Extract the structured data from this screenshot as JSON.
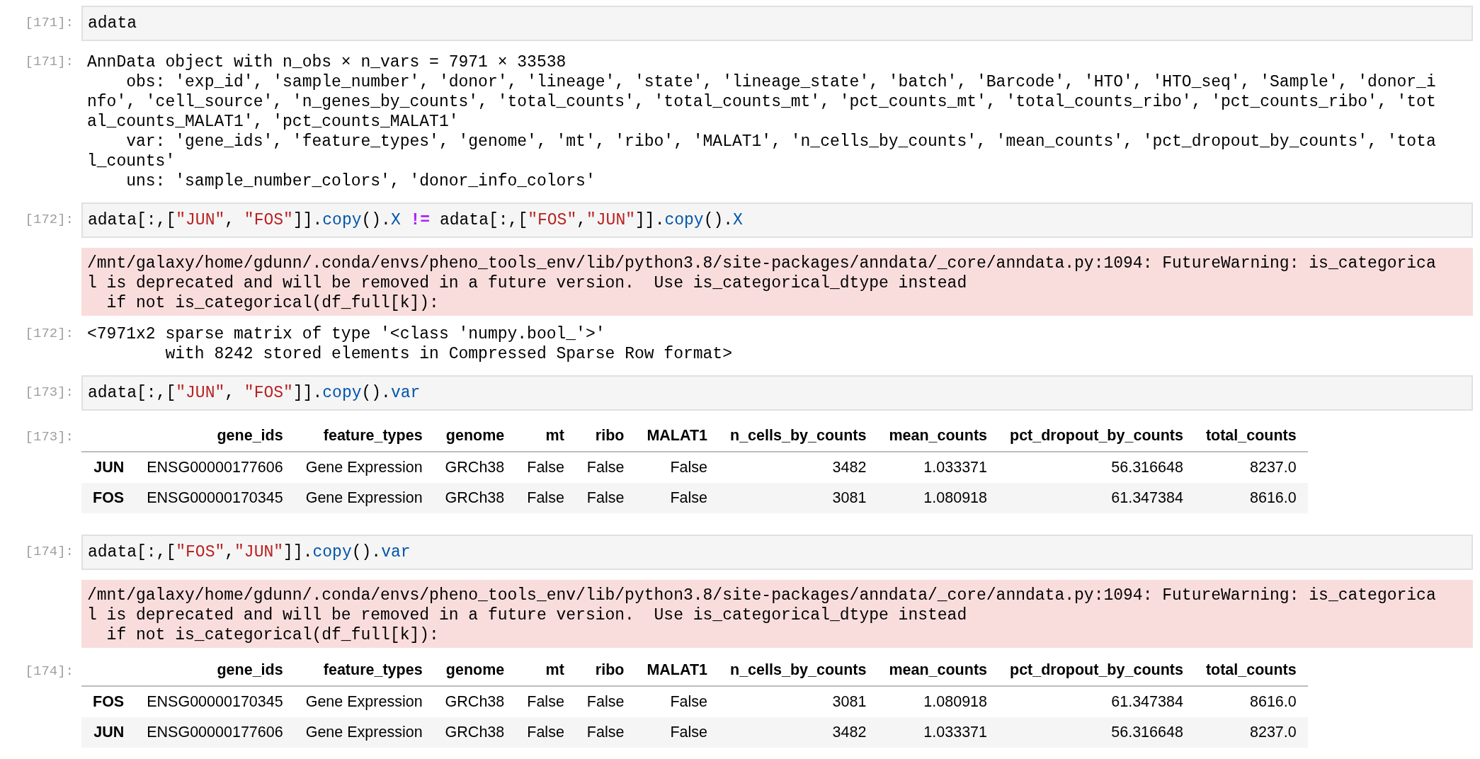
{
  "cells": [
    {
      "kind": "input",
      "prompt": "[171]:",
      "code": [
        {
          "kind": "plain",
          "text": "adata"
        }
      ]
    },
    {
      "kind": "text",
      "prompt": "[171]:",
      "text": "AnnData object with n_obs × n_vars = 7971 × 33538\n    obs: 'exp_id', 'sample_number', 'donor', 'lineage', 'state', 'lineage_state', 'batch', 'Barcode', 'HTO', 'HTO_seq', 'Sample', 'donor_i\nnfo', 'cell_source', 'n_genes_by_counts', 'total_counts', 'total_counts_mt', 'pct_counts_mt', 'total_counts_ribo', 'pct_counts_ribo', 'tot\nal_counts_MALAT1', 'pct_counts_MALAT1'\n    var: 'gene_ids', 'feature_types', 'genome', 'mt', 'ribo', 'MALAT1', 'n_cells_by_counts', 'mean_counts', 'pct_dropout_by_counts', 'tota\nl_counts'\n    uns: 'sample_number_colors', 'donor_info_colors'"
    },
    {
      "kind": "input",
      "prompt": "[172]:",
      "code": [
        {
          "kind": "plain",
          "text": "adata[:,["
        },
        {
          "kind": "string",
          "text": "\"JUN\""
        },
        {
          "kind": "plain",
          "text": ", "
        },
        {
          "kind": "string",
          "text": "\"FOS\""
        },
        {
          "kind": "plain",
          "text": "]]."
        },
        {
          "kind": "attr",
          "text": "copy"
        },
        {
          "kind": "plain",
          "text": "()."
        },
        {
          "kind": "attr",
          "text": "X "
        },
        {
          "kind": "operator",
          "text": "!="
        },
        {
          "kind": "plain",
          "text": " adata[:,["
        },
        {
          "kind": "string",
          "text": "\"FOS\""
        },
        {
          "kind": "plain",
          "text": ","
        },
        {
          "kind": "string",
          "text": "\"JUN\""
        },
        {
          "kind": "plain",
          "text": "]]."
        },
        {
          "kind": "attr",
          "text": "copy"
        },
        {
          "kind": "plain",
          "text": "()."
        },
        {
          "kind": "attr",
          "text": "X"
        }
      ]
    },
    {
      "kind": "stderr",
      "text": "/mnt/galaxy/home/gdunn/.conda/envs/pheno_tools_env/lib/python3.8/site-packages/anndata/_core/anndata.py:1094: FutureWarning: is_categorica\nl is deprecated and will be removed in a future version.  Use is_categorical_dtype instead\n  if not is_categorical(df_full[k]):"
    },
    {
      "kind": "text",
      "prompt": "[172]:",
      "text": "<7971x2 sparse matrix of type '<class 'numpy.bool_'>'\n\twith 8242 stored elements in Compressed Sparse Row format>"
    },
    {
      "kind": "input",
      "prompt": "[173]:",
      "code": [
        {
          "kind": "plain",
          "text": "adata[:,["
        },
        {
          "kind": "string",
          "text": "\"JUN\""
        },
        {
          "kind": "plain",
          "text": ", "
        },
        {
          "kind": "string",
          "text": "\"FOS\""
        },
        {
          "kind": "plain",
          "text": "]]."
        },
        {
          "kind": "attr",
          "text": "copy"
        },
        {
          "kind": "plain",
          "text": "()."
        },
        {
          "kind": "attr",
          "text": "var"
        }
      ]
    },
    {
      "kind": "table",
      "prompt": "[173]:",
      "columns": [
        "gene_ids",
        "feature_types",
        "genome",
        "mt",
        "ribo",
        "MALAT1",
        "n_cells_by_counts",
        "mean_counts",
        "pct_dropout_by_counts",
        "total_counts"
      ],
      "rows": [
        {
          "index": "JUN",
          "cells": [
            "ENSG00000177606",
            "Gene Expression",
            "GRCh38",
            "False",
            "False",
            "False",
            "3482",
            "1.033371",
            "56.316648",
            "8237.0"
          ]
        },
        {
          "index": "FOS",
          "cells": [
            "ENSG00000170345",
            "Gene Expression",
            "GRCh38",
            "False",
            "False",
            "False",
            "3081",
            "1.080918",
            "61.347384",
            "8616.0"
          ]
        }
      ]
    },
    {
      "kind": "input",
      "prompt": "[174]:",
      "code": [
        {
          "kind": "plain",
          "text": "adata[:,["
        },
        {
          "kind": "string",
          "text": "\"FOS\""
        },
        {
          "kind": "plain",
          "text": ","
        },
        {
          "kind": "string",
          "text": "\"JUN\""
        },
        {
          "kind": "plain",
          "text": "]]."
        },
        {
          "kind": "attr",
          "text": "copy"
        },
        {
          "kind": "plain",
          "text": "()."
        },
        {
          "kind": "attr",
          "text": "var"
        }
      ]
    },
    {
      "kind": "stderr",
      "text": "/mnt/galaxy/home/gdunn/.conda/envs/pheno_tools_env/lib/python3.8/site-packages/anndata/_core/anndata.py:1094: FutureWarning: is_categorica\nl is deprecated and will be removed in a future version.  Use is_categorical_dtype instead\n  if not is_categorical(df_full[k]):"
    },
    {
      "kind": "table",
      "prompt": "[174]:",
      "columns": [
        "gene_ids",
        "feature_types",
        "genome",
        "mt",
        "ribo",
        "MALAT1",
        "n_cells_by_counts",
        "mean_counts",
        "pct_dropout_by_counts",
        "total_counts"
      ],
      "rows": [
        {
          "index": "FOS",
          "cells": [
            "ENSG00000170345",
            "Gene Expression",
            "GRCh38",
            "False",
            "False",
            "False",
            "3081",
            "1.080918",
            "61.347384",
            "8616.0"
          ]
        },
        {
          "index": "JUN",
          "cells": [
            "ENSG00000177606",
            "Gene Expression",
            "GRCh38",
            "False",
            "False",
            "False",
            "3482",
            "1.033371",
            "56.316648",
            "8237.0"
          ]
        }
      ]
    }
  ]
}
